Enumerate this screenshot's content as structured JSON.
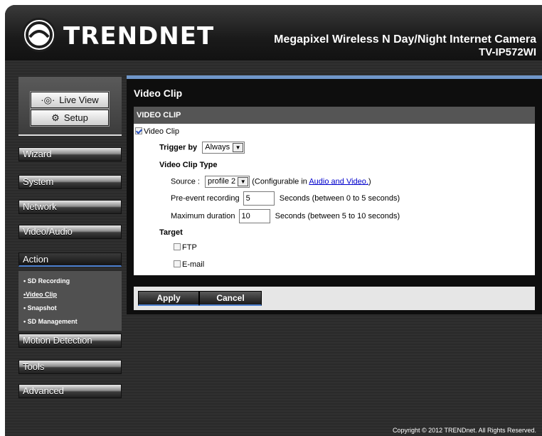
{
  "header": {
    "brand": "TRENDNET",
    "title": "Megapixel Wireless N Day/Night Internet Camera",
    "model": "TV-IP572WI"
  },
  "topnav": {
    "live_view": "Live View",
    "setup": "Setup"
  },
  "sidebar": {
    "items": [
      {
        "label": "Wizard"
      },
      {
        "label": "System"
      },
      {
        "label": "Network"
      },
      {
        "label": "Video/Audio"
      },
      {
        "label": "Action"
      },
      {
        "label": "Motion Detection"
      },
      {
        "label": "Tools"
      },
      {
        "label": "Advanced"
      }
    ],
    "action_submenu": [
      {
        "label": "• SD Recording"
      },
      {
        "label": "•Video Clip"
      },
      {
        "label": "• Snapshot"
      },
      {
        "label": "• SD Management"
      }
    ]
  },
  "main": {
    "page_title": "Video Clip",
    "section_header": "VIDEO CLIP",
    "video_clip_checkbox_label": "Video Clip",
    "trigger_label": "Trigger by",
    "trigger_value": "Always",
    "clip_type_label": "Video Clip Type",
    "source_label": "Source :",
    "source_value": "profile 2",
    "configurable_prefix": "(Configurable in",
    "configurable_link": "Audio and Video.",
    "configurable_suffix": ")",
    "pre_event_label": "Pre-event recording",
    "pre_event_value": "5",
    "pre_event_hint": "Seconds  (between 0 to 5 seconds)",
    "max_duration_label": "Maximum duration",
    "max_duration_value": "10",
    "max_duration_hint": "Seconds  (between 5 to 10 seconds)",
    "target_label": "Target",
    "ftp_label": "FTP",
    "email_label": "E-mail",
    "apply_label": "Apply",
    "cancel_label": "Cancel"
  },
  "footer": {
    "copyright": "Copyright © 2012 TRENDnet. All Rights Reserved."
  }
}
